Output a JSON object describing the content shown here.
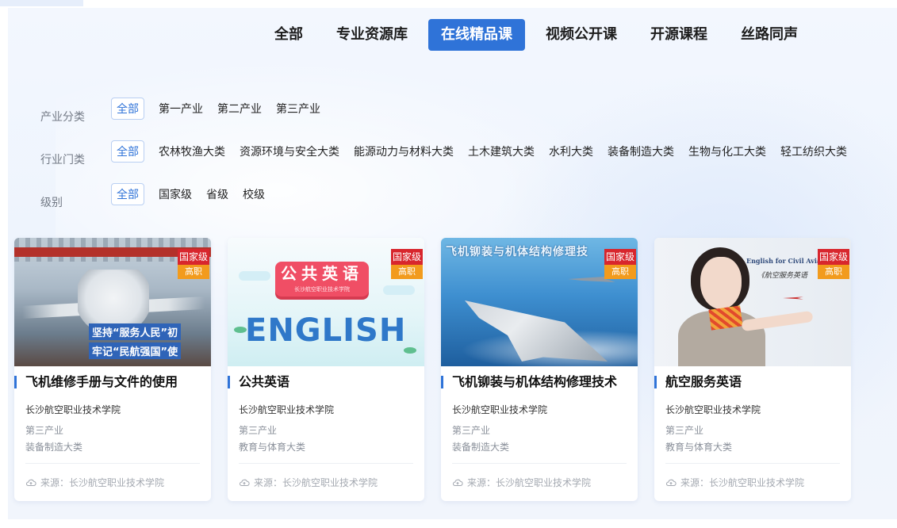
{
  "nav": {
    "tabs": [
      {
        "label": "全部",
        "active": false
      },
      {
        "label": "专业资源库",
        "active": false
      },
      {
        "label": "在线精品课",
        "active": true
      },
      {
        "label": "视频公开课",
        "active": false
      },
      {
        "label": "开源课程",
        "active": false
      },
      {
        "label": "丝路同声",
        "active": false
      }
    ],
    "active_color": "#2f73d8"
  },
  "filters": {
    "industry_sector": {
      "label": "产业分类",
      "options": [
        "全部",
        "第一产业",
        "第二产业",
        "第三产业"
      ],
      "selected": "全部"
    },
    "industry_category": {
      "label": "行业门类",
      "options": [
        "全部",
        "农林牧渔大类",
        "资源环境与安全大类",
        "能源动力与材料大类",
        "土木建筑大类",
        "水利大类",
        "装备制造大类",
        "生物与化工大类",
        "轻工纺织大类"
      ],
      "selected": "全部"
    },
    "level": {
      "label": "级别",
      "options": [
        "全部",
        "国家级",
        "省级",
        "校级"
      ],
      "selected": "全部"
    }
  },
  "cards": [
    {
      "title": "飞机维修手册与文件的使用",
      "school": "长沙航空职业技术学院",
      "industry": "第三产业",
      "category": "装备制造大类",
      "source": "来源：长沙航空职业技术学院",
      "badge_level": "国家级",
      "badge_type": "高职",
      "image": {
        "sign1": "坚持“服务人民”初",
        "sign2": "牢记“民航强国”使"
      }
    },
    {
      "title": "公共英语",
      "school": "长沙航空职业技术学院",
      "industry": "第三产业",
      "category": "教育与体育大类",
      "source": "来源：长沙航空职业技术学院",
      "badge_level": "国家级",
      "badge_type": "高职",
      "image": {
        "pill_title": "公共英语",
        "pill_sub": "长沙航空职业技术学院",
        "big_word": "ENGLISH"
      }
    },
    {
      "title": "飞机铆装与机体结构修理技术",
      "school": "长沙航空职业技术学院",
      "industry": "第三产业",
      "category": "装备制造大类",
      "source": "来源：长沙航空职业技术学院",
      "badge_level": "国家级",
      "badge_type": "高职",
      "image": {
        "banner": "飞机铆装与机体结构修理技"
      }
    },
    {
      "title": "航空服务英语",
      "school": "长沙航空职业技术学院",
      "industry": "第三产业",
      "category": "教育与体育大类",
      "source": "来源：长沙航空职业技术学院",
      "badge_level": "国家级",
      "badge_type": "高职",
      "image": {
        "en_title": "English for Civil Aviation",
        "cn_title": "《航空服务英语"
      }
    }
  ],
  "colors": {
    "badge_level": "#d8262d",
    "badge_type": "#f29b1d",
    "accent": "#2f73d8"
  }
}
